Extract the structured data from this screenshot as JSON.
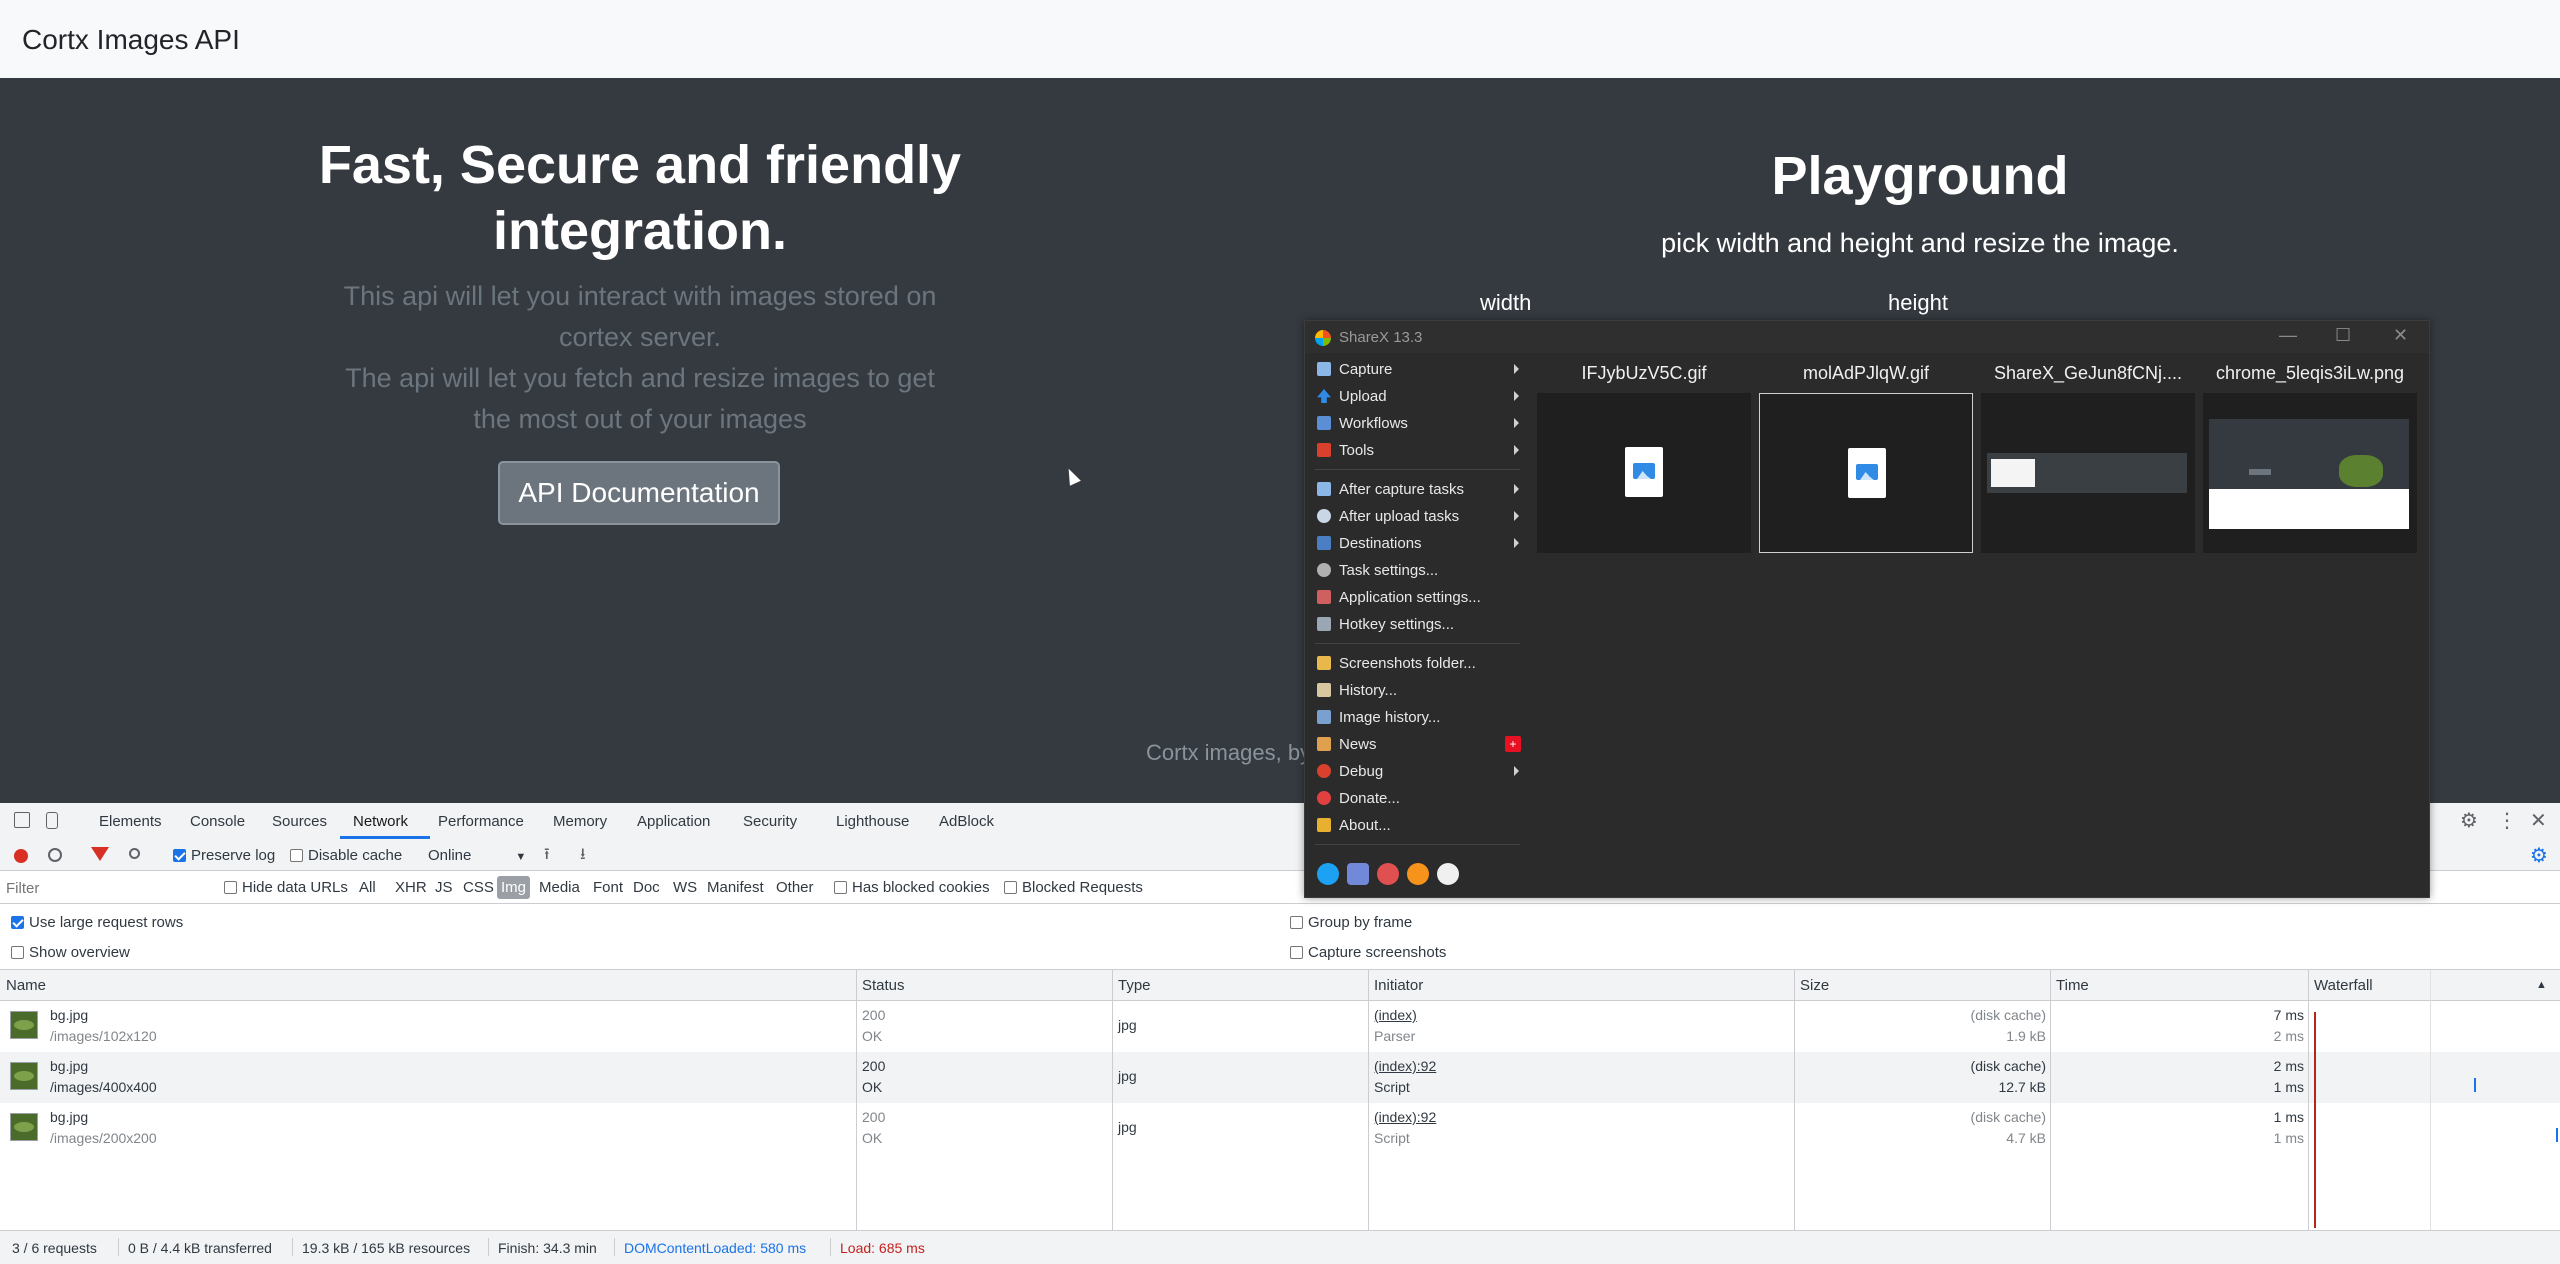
{
  "page": {
    "brand": "Cortx Images API",
    "hero_title": "Fast, Secure and friendly integration.",
    "hero_desc_1": "This api will let you interact with images stored on cortex server.",
    "hero_desc_2": "The api will let you fetch and resize images to get the most out of your images",
    "hero_button": "API Documentation",
    "playground_title": "Playground",
    "playground_sub": "pick width and height and resize the image.",
    "width_label": "width",
    "height_label": "height",
    "footer": "Cortx images, by"
  },
  "devtools": {
    "tabs": [
      "Elements",
      "Console",
      "Sources",
      "Network",
      "Performance",
      "Memory",
      "Application",
      "Security",
      "Lighthouse",
      "AdBlock"
    ],
    "active_tab": "Network",
    "preserve_log": "Preserve log",
    "disable_cache": "Disable cache",
    "throttle": "Online",
    "filter_placeholder": "Filter",
    "hide_data_urls": "Hide data URLs",
    "filter_types": [
      "All",
      "XHR",
      "JS",
      "CSS",
      "Img",
      "Media",
      "Font",
      "Doc",
      "WS",
      "Manifest",
      "Other"
    ],
    "active_filter": "Img",
    "has_blocked_cookies": "Has blocked cookies",
    "blocked_requests": "Blocked Requests",
    "use_large_rows": "Use large request rows",
    "show_overview": "Show overview",
    "group_by_frame": "Group by frame",
    "capture_screenshots": "Capture screenshots",
    "columns": [
      "Name",
      "Status",
      "Type",
      "Initiator",
      "Size",
      "Time",
      "Waterfall"
    ],
    "rows": [
      {
        "name": "bg.jpg",
        "path": "/images/102x120",
        "status": "200",
        "status_text": "OK",
        "type": "jpg",
        "initiator": "(index)",
        "initiator_sub": "Parser",
        "size": "(disk cache)",
        "size_sub": "1.9 kB",
        "time": "7 ms",
        "time_sub": "2 ms"
      },
      {
        "name": "bg.jpg",
        "path": "/images/400x400",
        "status": "200",
        "status_text": "OK",
        "type": "jpg",
        "initiator": "(index):92",
        "initiator_sub": "Script",
        "size": "(disk cache)",
        "size_sub": "12.7 kB",
        "time": "2 ms",
        "time_sub": "1 ms"
      },
      {
        "name": "bg.jpg",
        "path": "/images/200x200",
        "status": "200",
        "status_text": "OK",
        "type": "jpg",
        "initiator": "(index):92",
        "initiator_sub": "Script",
        "size": "(disk cache)",
        "size_sub": "4.7 kB",
        "time": "1 ms",
        "time_sub": "1 ms"
      }
    ],
    "status_bar": {
      "requests": "3 / 6 requests",
      "transferred": "0 B / 4.4 kB transferred",
      "resources": "19.3 kB / 165 kB resources",
      "finish": "Finish: 34.3 min",
      "dcl": "DOMContentLoaded: 580 ms",
      "load": "Load: 685 ms"
    },
    "colors": {
      "dcl": "#1a73e8",
      "load": "#c5221f"
    }
  },
  "sharex": {
    "title": "ShareX 13.3",
    "menu": [
      {
        "label": "Capture",
        "icon": "capture-icon",
        "submenu": true
      },
      {
        "label": "Upload",
        "icon": "upload-icon",
        "submenu": true
      },
      {
        "label": "Workflows",
        "icon": "workflows-icon",
        "submenu": true
      },
      {
        "label": "Tools",
        "icon": "tools-icon",
        "submenu": true
      },
      {
        "label": "After capture tasks",
        "icon": "after-capture-icon",
        "submenu": true
      },
      {
        "label": "After upload tasks",
        "icon": "after-upload-icon",
        "submenu": true
      },
      {
        "label": "Destinations",
        "icon": "destinations-icon",
        "submenu": true
      },
      {
        "label": "Task settings...",
        "icon": "task-settings-icon",
        "submenu": false
      },
      {
        "label": "Application settings...",
        "icon": "application-settings-icon",
        "submenu": false
      },
      {
        "label": "Hotkey settings...",
        "icon": "hotkey-settings-icon",
        "submenu": false
      },
      {
        "label": "Screenshots folder...",
        "icon": "folder-icon",
        "submenu": false
      },
      {
        "label": "History...",
        "icon": "history-icon",
        "submenu": false
      },
      {
        "label": "Image history...",
        "icon": "image-history-icon",
        "submenu": false
      },
      {
        "label": "News",
        "icon": "news-icon",
        "submenu": false,
        "badge": "+"
      },
      {
        "label": "Debug",
        "icon": "debug-icon",
        "submenu": true
      },
      {
        "label": "Donate...",
        "icon": "heart-icon",
        "submenu": false
      },
      {
        "label": "About...",
        "icon": "crown-icon",
        "submenu": false
      }
    ],
    "files": [
      {
        "name": "IFJybUzV5C.gif"
      },
      {
        "name": "molAdPJlqW.gif"
      },
      {
        "name": "ShareX_GeJun8fCNj...."
      },
      {
        "name": "chrome_5leqis3iLw.png"
      }
    ]
  }
}
